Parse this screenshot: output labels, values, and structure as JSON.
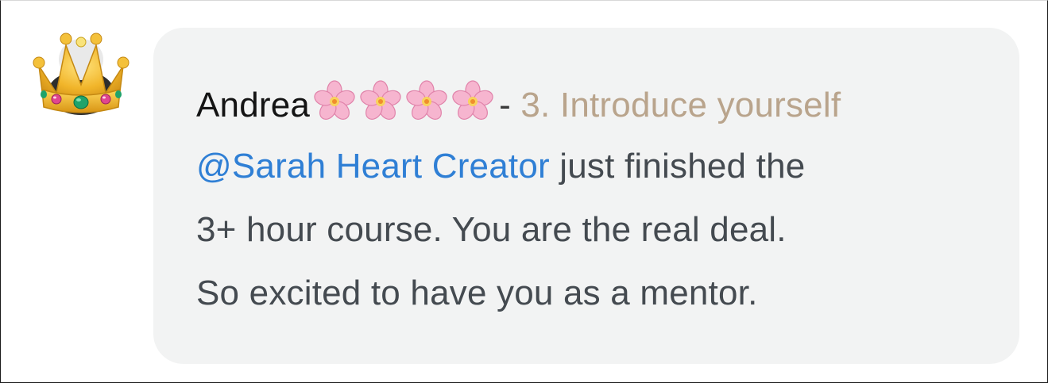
{
  "comment": {
    "author": "Andrea",
    "separator": "-",
    "topic": "3. Introduce yourself",
    "mention": "@Sarah Heart Creator",
    "text_line1": " just finished the",
    "text_line2": "3+ hour course. You are the real deal.",
    "text_line3": "So excited to have you as a mentor."
  },
  "icons": {
    "avatar": "crown-emoji-icon",
    "author_decoration": "cherry-blossom-icon"
  },
  "colors": {
    "mention": "#2f7fd5",
    "topic": "#b9a48c",
    "bubble": "#f2f3f3",
    "text": "#444a50"
  }
}
